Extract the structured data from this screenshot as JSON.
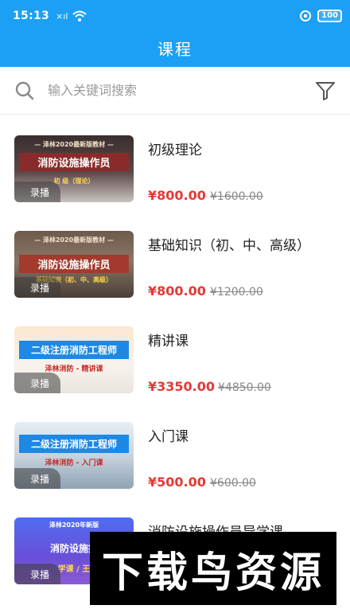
{
  "status_bar": {
    "time": "15:13",
    "signal": "×ıl",
    "battery": "100"
  },
  "header": {
    "title": "课程"
  },
  "search": {
    "placeholder": "输入关键词搜索"
  },
  "courses": [
    {
      "title": "初级理论",
      "price": "¥800.00",
      "old_price": "¥1600.00",
      "badge": "录播",
      "thumb_top": "— 泽林2020最新版教材 —",
      "thumb_main": "消防设施操作员",
      "thumb_sub": "初 级（理论）"
    },
    {
      "title": "基础知识（初、中、高级）",
      "price": "¥800.00",
      "old_price": "¥1200.00",
      "badge": "录播",
      "thumb_top": "— 泽林2020最新版教材 —",
      "thumb_main": "消防设施操作员",
      "thumb_sub": "基础知识（初、中、高级）"
    },
    {
      "title": "精讲课",
      "price": "¥3350.00",
      "old_price": "¥4850.00",
      "badge": "录播",
      "thumb_top": "",
      "thumb_main": "二级注册消防工程师",
      "thumb_sub": "泽林消防 - 精讲课"
    },
    {
      "title": "入门课",
      "price": "¥500.00",
      "old_price": "¥600.00",
      "badge": "录播",
      "thumb_top": "",
      "thumb_main": "二级注册消防工程师",
      "thumb_sub": "泽林消防 - 入门课"
    },
    {
      "title": "消防设施操作员导学课",
      "price": "",
      "old_price": "",
      "badge": "录播",
      "thumb_top": "泽林2020年新版",
      "thumb_main": "消防设施操",
      "thumb_sub": "学课 / 王"
    }
  ],
  "watermark": {
    "text": "下载鸟资源"
  },
  "colors": {
    "primary": "#1ba0f5",
    "price": "#e53935"
  },
  "icons": [
    "search-icon",
    "filter-icon",
    "lock-icon",
    "battery-icon",
    "wifi-icon"
  ]
}
